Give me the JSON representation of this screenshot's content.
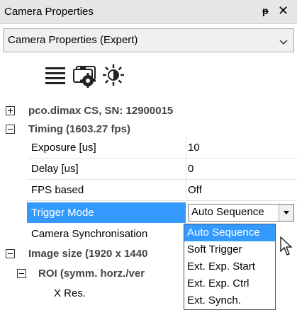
{
  "window": {
    "title": "Camera Properties",
    "pin_glyph": "ᵽ",
    "close_glyph": "✕"
  },
  "view_select": {
    "value": "Camera Properties (Expert)"
  },
  "toolbar": {
    "icons": [
      "list-icon",
      "camera-settings-icon",
      "brightness-icon"
    ]
  },
  "tree": {
    "camera_node": "pco.dimax CS, SN: 12900015",
    "timing_node": "Timing (1603.27 fps)",
    "properties": [
      {
        "name": "Exposure [us]",
        "value": "10"
      },
      {
        "name": "Delay [us]",
        "value": "0"
      },
      {
        "name": "FPS based",
        "value": "Off"
      },
      {
        "name": "Trigger Mode",
        "value": "Auto Sequence"
      },
      {
        "name": "Camera Synchronisation",
        "value": ""
      }
    ],
    "image_size_node": "Image size (1920 x 1440",
    "roi_node": "ROI (symm. horz./ver",
    "xres_label": "X Res."
  },
  "dropdown": {
    "options": [
      "Auto Sequence",
      "Soft Trigger",
      "Ext. Exp. Start",
      "Ext. Exp. Ctrl",
      "Ext. Synch."
    ],
    "selected_index": 0
  },
  "colors": {
    "selection": "#3399ff",
    "category_text": "#444444"
  }
}
